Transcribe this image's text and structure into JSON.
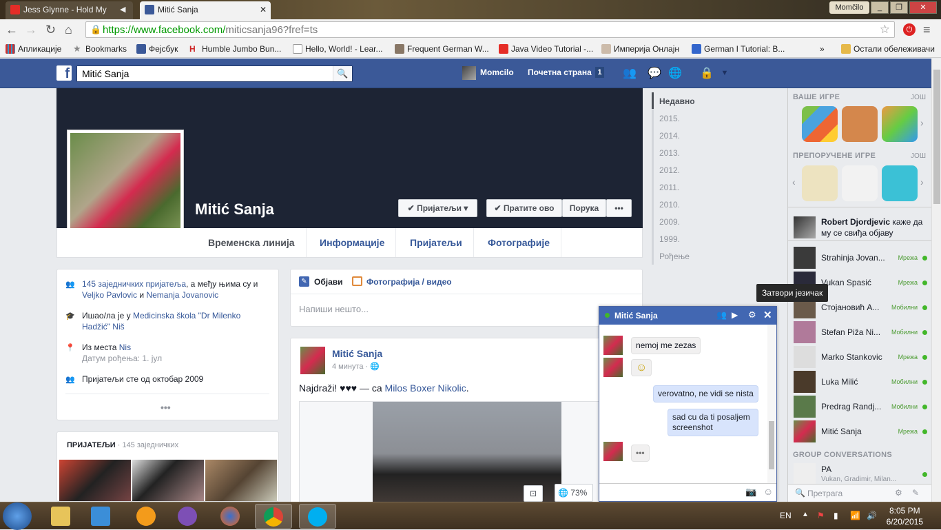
{
  "browser": {
    "tabs": [
      {
        "title": "Jess Glynne - Hold My",
        "icon": "youtube-icon",
        "active": false
      },
      {
        "title": "Mitić Sanja",
        "icon": "facebook-icon",
        "active": true
      }
    ],
    "user_label": "Momčilo",
    "url_main": "https://www.facebook.com/",
    "url_path": "miticsanja96?fref=ts",
    "bookmarks": [
      {
        "label": "Апликације",
        "icon": "apps-grid-icon"
      },
      {
        "label": "Bookmarks",
        "icon": "star-icon"
      },
      {
        "label": "Фејсбук",
        "icon": "facebook-icon"
      },
      {
        "label": "Humble Jumbo Bun...",
        "icon": "humble-icon"
      },
      {
        "label": "Hello, World! - Lear...",
        "icon": "page-icon"
      },
      {
        "label": "Frequent German W...",
        "icon": "image-icon"
      },
      {
        "label": "Java Video Tutorial -...",
        "icon": "youtube-icon"
      },
      {
        "label": "Империја Онлајн",
        "icon": "crest-icon"
      },
      {
        "label": "German I Tutorial: B...",
        "icon": "site-icon"
      }
    ],
    "bookmarks_overflow": "»",
    "other_bookmarks": "Остали обележивачи"
  },
  "fb_header": {
    "logo": "f",
    "search_value": "Mitić Sanja",
    "user_name": "Momcilo",
    "home_label": "Почетна страна",
    "home_count": "1"
  },
  "profile": {
    "name": "Mitić Sanja",
    "friends_btn": "Пријатељи",
    "follow_btn": "Пратите ово",
    "message_btn": "Порука",
    "more_btn": "•••",
    "tabs": [
      "Временска линија",
      "Информације",
      "Пријатељи",
      "Фотографије"
    ]
  },
  "intro": {
    "mutual_link": "145 заједничких пријатеља",
    "mutual_mid": ", а међу њима су и ",
    "mutual_p1": "Veljko Pavlovic",
    "mutual_and": " и ",
    "mutual_p2": "Nemanja Jovanovic",
    "school_pre": "Ишао/ла је у ",
    "school": "Medicinska škola \"Dr Milenko Hadžić\" Niš",
    "from_pre": "Из места ",
    "from": "Nis",
    "birthday": "Датум рођења: 1. јул",
    "friends_since": "Пријатељи сте од октобар 2009",
    "more": "•••"
  },
  "friends_card": {
    "title": "ПРИЈАТЕЉИ",
    "sub": " · 145 заједничких"
  },
  "composer": {
    "post_tab": "Објави",
    "photo_tab": "Фотографија / видео",
    "placeholder": "Напиши нешто..."
  },
  "post": {
    "author": "Mitić Sanja",
    "time": "4 минута",
    "text": "Najdraži! ♥♥♥ — са ",
    "tag": "Milos Boxer Nikolic",
    "tag_end": ".",
    "zoom": "73%"
  },
  "years": [
    "Недавно",
    "2015.",
    "2014.",
    "2013.",
    "2012.",
    "2011.",
    "2010.",
    "2009.",
    "1999.",
    "Рођење"
  ],
  "sidebar": {
    "games_title": "ВАШЕ ИГРЕ",
    "more": "ЈОШ",
    "recommended_title": "ПРЕПОРУЧЕНЕ ИГРЕ",
    "ticker_name": "Robert Djordjevic",
    "ticker_text": " каже да му се свиђа објаву",
    "contacts": [
      {
        "name": "Strahinja Jovan...",
        "status": "Мрежа"
      },
      {
        "name": "Vukan Spasić",
        "status": "Мрежа"
      },
      {
        "name": "Стојановић А...",
        "status": "Мобилни"
      },
      {
        "name": "Stefan Piža Ni...",
        "status": "Мобилни"
      },
      {
        "name": "Marko Stankovic",
        "status": "Мрежа"
      },
      {
        "name": "Luka Milić",
        "status": "Мобилни"
      },
      {
        "name": "Predrag Randj...",
        "status": "Мобилни"
      },
      {
        "name": "Mitić Sanja",
        "status": "Мрежа"
      }
    ],
    "group_title": "GROUP CONVERSATIONS",
    "group_name": "PA",
    "group_members": "Vukan, Gradimir, Milan...",
    "search_placeholder": "Претрага"
  },
  "chat": {
    "title": "Mitić Sanja",
    "tooltip": "Затвори језичак",
    "messages": [
      {
        "text": "nemoj me zezas",
        "dir": "in"
      },
      {
        "text": "☺",
        "dir": "in"
      },
      {
        "text": "verovatno, ne vidi se nista",
        "dir": "out"
      },
      {
        "text": "sad cu da ti posaljem screenshot",
        "dir": "out"
      },
      {
        "text": "•••",
        "dir": "in"
      }
    ]
  },
  "taskbar": {
    "lang": "EN",
    "time": "8:05 PM",
    "date": "6/20/2015"
  }
}
